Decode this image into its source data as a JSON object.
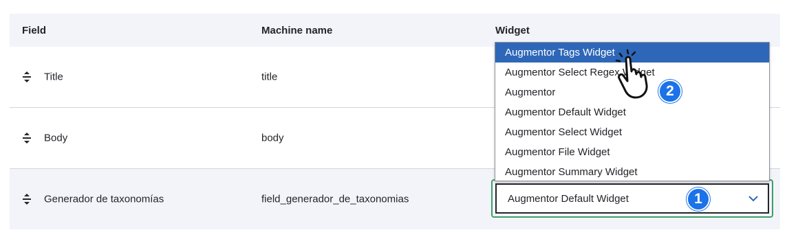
{
  "table": {
    "headers": {
      "field": "Field",
      "machine_name": "Machine name",
      "widget": "Widget"
    },
    "rows": [
      {
        "field": "Title",
        "machine_name": "title"
      },
      {
        "field": "Body",
        "machine_name": "body"
      },
      {
        "field": "Generador de taxonomías",
        "machine_name": "field_generador_de_taxonomias",
        "widget": "Augmentor Default Widget"
      }
    ]
  },
  "dropdown": {
    "options": [
      "Augmentor Tags Widget",
      "Augmentor Select Regex Widget",
      "Augmentor",
      "Augmentor Default Widget",
      "Augmentor Select Widget",
      "Augmentor File Widget",
      "Augmentor Summary Widget"
    ],
    "highlighted": "Augmentor Tags Widget"
  },
  "callouts": {
    "step1": "1",
    "step2": "2"
  },
  "colors": {
    "accent": "#2e67b8",
    "focus_border": "#3aa067",
    "badge": "#1c72e8",
    "header_bg": "#f3f4f9"
  },
  "icons": {
    "drag": "drag-handle-icon",
    "chevron": "chevron-down-icon",
    "pointer": "hand-pointer-icon"
  }
}
